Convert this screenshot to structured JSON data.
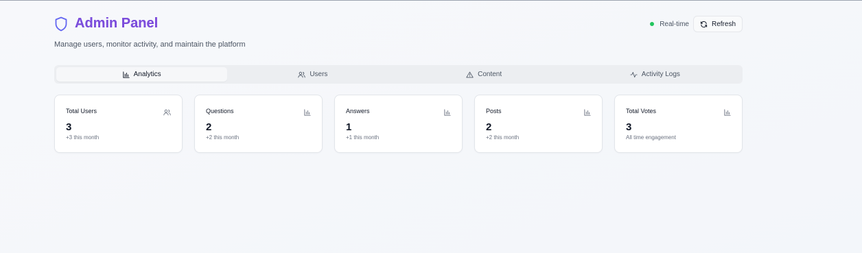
{
  "header": {
    "title": "Admin Panel",
    "subtitle": "Manage users, monitor activity, and maintain the platform",
    "realtime_label": "Real-time",
    "refresh_label": "Refresh",
    "icon": "shield-icon"
  },
  "tabs": [
    {
      "label": "Analytics",
      "icon": "bar-chart-icon",
      "active": true
    },
    {
      "label": "Users",
      "icon": "users-icon",
      "active": false
    },
    {
      "label": "Content",
      "icon": "alert-triangle-icon",
      "active": false
    },
    {
      "label": "Activity Logs",
      "icon": "activity-icon",
      "active": false
    }
  ],
  "stats": [
    {
      "label": "Total Users",
      "value": "3",
      "note": "+3 this month",
      "icon": "users-icon"
    },
    {
      "label": "Questions",
      "value": "2",
      "note": "+2 this month",
      "icon": "bar-chart-icon"
    },
    {
      "label": "Answers",
      "value": "1",
      "note": "+1 this month",
      "icon": "bar-chart-icon"
    },
    {
      "label": "Posts",
      "value": "2",
      "note": "+2 this month",
      "icon": "bar-chart-icon"
    },
    {
      "label": "Total Votes",
      "value": "3",
      "note": "All time engagement",
      "icon": "bar-chart-icon"
    }
  ],
  "colors": {
    "accent_start": "#6366f1",
    "accent_end": "#9333ea",
    "status_green": "#22c55e"
  }
}
